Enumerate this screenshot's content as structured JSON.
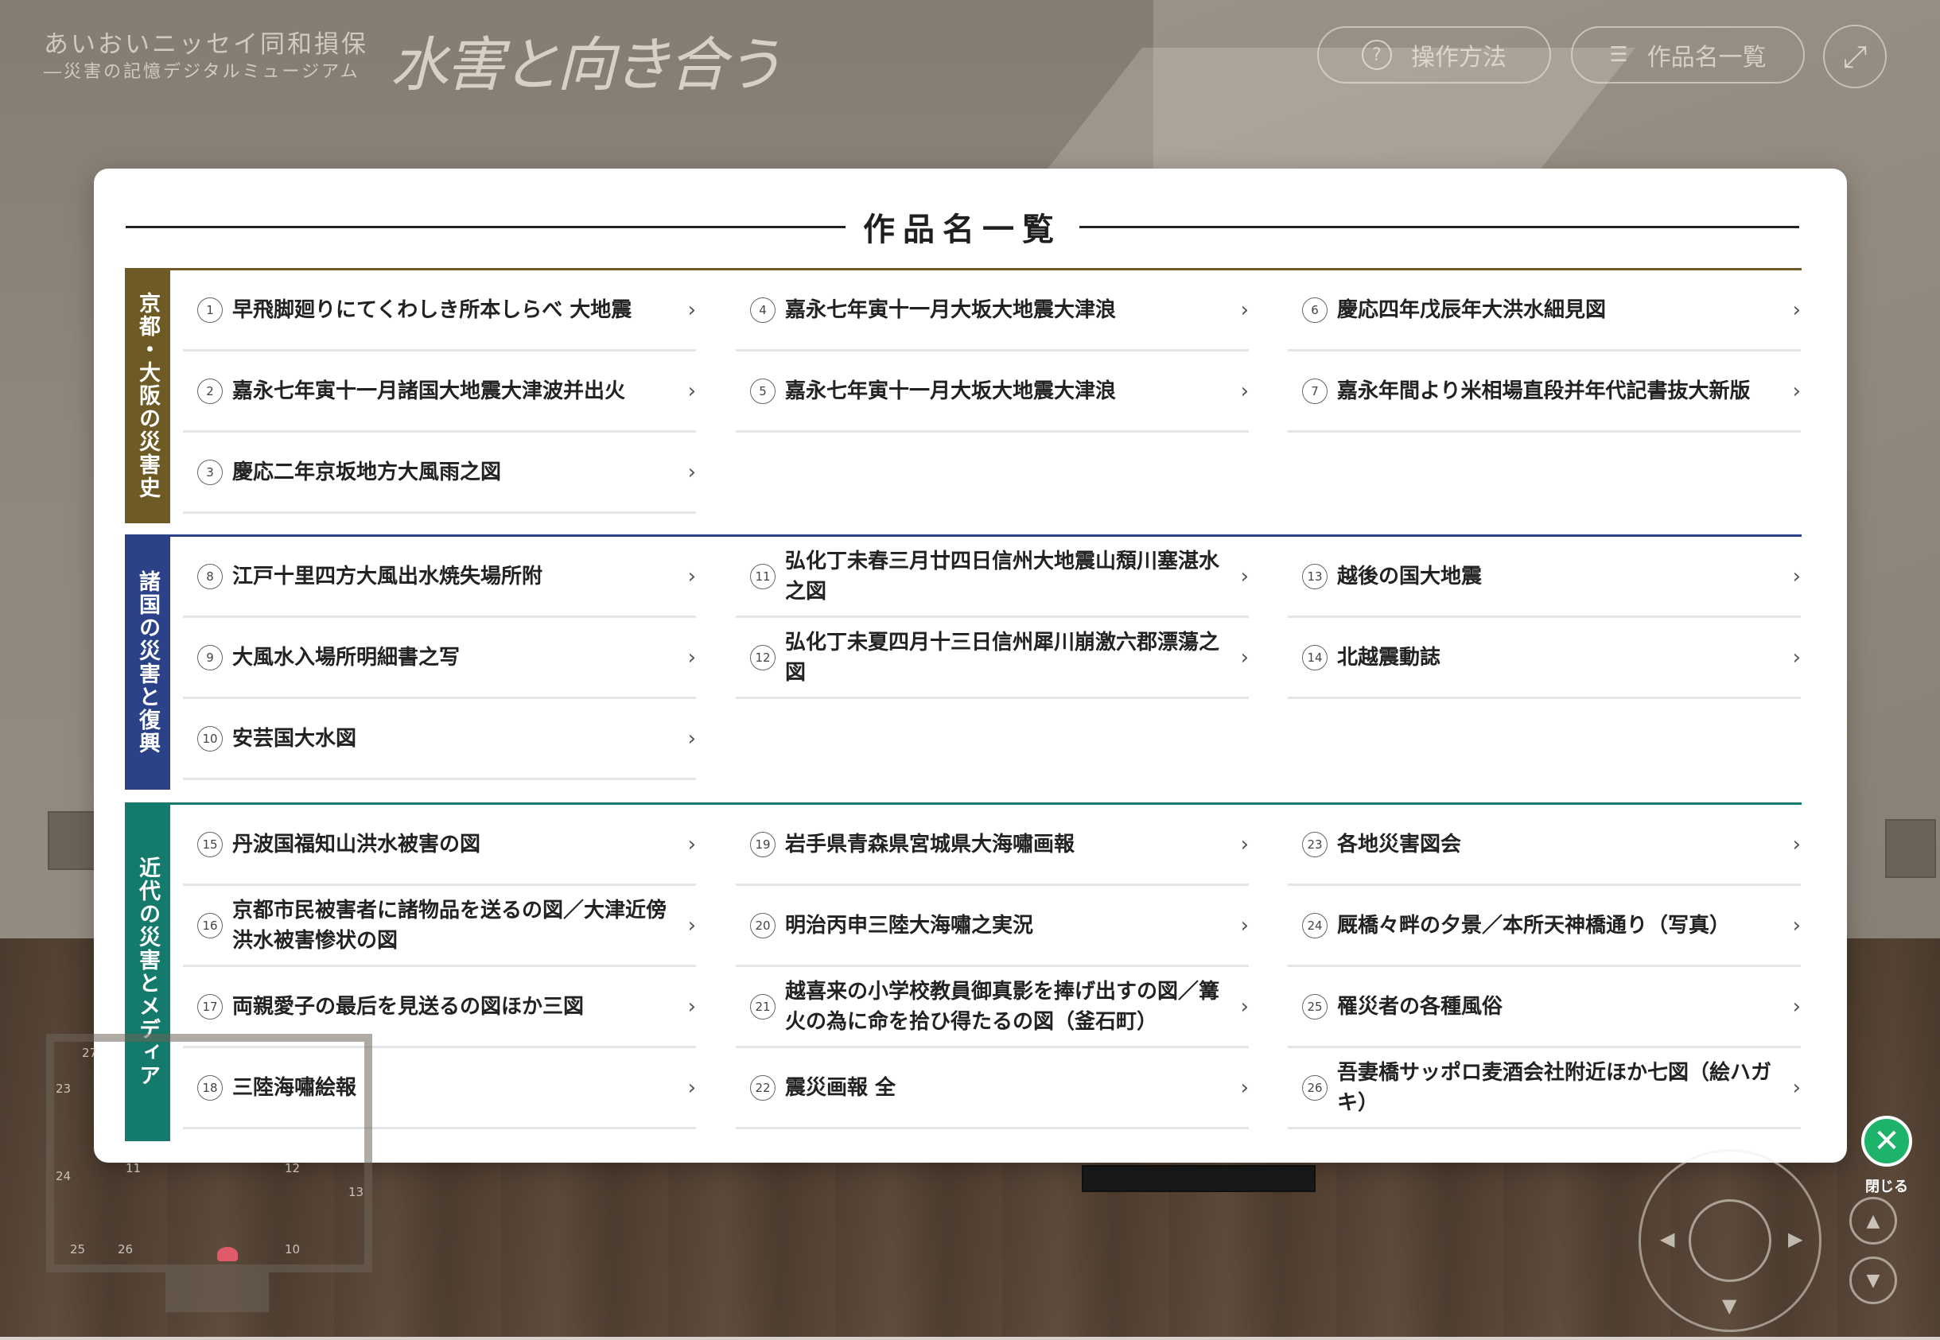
{
  "header": {
    "brand_line1": "あいおいニッセイ同和損保",
    "brand_line2": "―災害の記憶デジタルミュージアム",
    "brand_title": "水害と向き合う",
    "help_label": "操作方法",
    "list_label": "作品名一覧",
    "help_icon": "question-icon",
    "list_icon": "list-icon",
    "fullscreen_icon": "fullscreen-icon"
  },
  "modal": {
    "title": "作品名一覧",
    "sections": [
      {
        "label": "京都・大阪の災害史",
        "color": "#6e5a24",
        "columns": [
          [
            {
              "num": "1",
              "title": "早飛脚廻りにてくわしき所本しらべ 大地震"
            },
            {
              "num": "2",
              "title": "嘉永七年寅十一月諸国大地震大津波并出火"
            },
            {
              "num": "3",
              "title": "慶応二年京坂地方大風雨之図"
            }
          ],
          [
            {
              "num": "4",
              "title": "嘉永七年寅十一月大坂大地震大津浪"
            },
            {
              "num": "5",
              "title": "嘉永七年寅十一月大坂大地震大津浪"
            }
          ],
          [
            {
              "num": "6",
              "title": "慶応四年戊辰年大洪水細見図"
            },
            {
              "num": "7",
              "title": "嘉永年間より米相場直段并年代記書抜大新版"
            }
          ]
        ]
      },
      {
        "label": "諸国の災害と復興",
        "color": "#2b4288",
        "columns": [
          [
            {
              "num": "8",
              "title": "江戸十里四方大風出水焼失場所附"
            },
            {
              "num": "9",
              "title": "大風水入場所明細書之写"
            },
            {
              "num": "10",
              "title": "安芸国大水図"
            }
          ],
          [
            {
              "num": "11",
              "title": "弘化丁未春三月廿四日信州大地震山頽川塞湛水之図"
            },
            {
              "num": "12",
              "title": "弘化丁未夏四月十三日信州犀川崩激六郡漂蕩之図"
            }
          ],
          [
            {
              "num": "13",
              "title": "越後の国大地震"
            },
            {
              "num": "14",
              "title": "北越震動誌"
            }
          ]
        ]
      },
      {
        "label": "近代の災害とメディア",
        "color": "#147a6c",
        "columns": [
          [
            {
              "num": "15",
              "title": "丹波国福知山洪水被害の図"
            },
            {
              "num": "16",
              "title": "京都市民被害者に諸物品を送るの図／大津近傍洪水被害惨状の図"
            },
            {
              "num": "17",
              "title": "両親愛子の最后を見送るの図ほか三図"
            },
            {
              "num": "18",
              "title": "三陸海嘯絵報"
            }
          ],
          [
            {
              "num": "19",
              "title": "岩手県青森県宮城県大海嘯画報"
            },
            {
              "num": "20",
              "title": "明治丙申三陸大海嘯之実況"
            },
            {
              "num": "21",
              "title": "越喜来の小学校教員御真影を捧げ出すの図／篝火の為に命を拾ひ得たるの図（釜石町）"
            },
            {
              "num": "22",
              "title": "震災画報 全"
            }
          ],
          [
            {
              "num": "23",
              "title": "各地災害図会"
            },
            {
              "num": "24",
              "title": "厩橋々畔の夕景／本所天神橋通り（写真）"
            },
            {
              "num": "25",
              "title": "罹災者の各種風俗"
            },
            {
              "num": "26",
              "title": "吾妻橋サッポロ麦酒会社附近ほか七図（絵ハガキ）"
            }
          ]
        ]
      }
    ]
  },
  "controls": {
    "close_label": "閉じる",
    "close_color": "#1db36b",
    "minimap_numbers": [
      "27",
      "23",
      "24",
      "25",
      "26",
      "11",
      "12",
      "10",
      "13"
    ]
  }
}
